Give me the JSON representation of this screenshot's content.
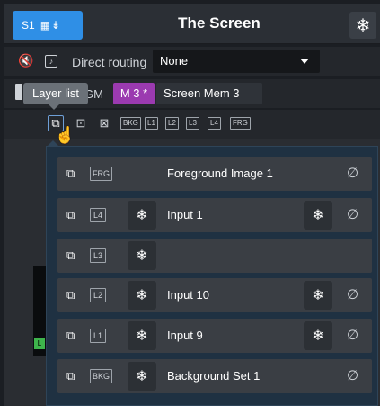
{
  "header": {
    "screen_badge": "S1",
    "screen_badge_icons": "▦⇟",
    "title": "The Screen",
    "freeze_icon": "❄"
  },
  "routing": {
    "mute_icon": "🔇",
    "checkbox_glyph": "♪",
    "label": "Direct routing",
    "selected": "None"
  },
  "memory": {
    "tooltip": "Layer list",
    "gm_label": "GM",
    "badge": "M 3 *",
    "name": "Screen Mem 3"
  },
  "toolbar": {
    "layer_list_icon": "⧉",
    "icon2": "⊡",
    "icon3": "⊠",
    "chips": [
      "BKG",
      "L1",
      "L2",
      "L3",
      "L4",
      "FRG"
    ],
    "cursor": "☝"
  },
  "side": {
    "green_label": "L"
  },
  "layers": [
    {
      "stack_icon": "⧉",
      "chip": "FRG",
      "freeze": "",
      "name": "Foreground Image 1",
      "freeze_right": "",
      "none": "∅"
    },
    {
      "stack_icon": "⧉",
      "chip": "L4",
      "freeze": "❄",
      "name": "Input 1",
      "freeze_right": "❄",
      "none": "∅"
    },
    {
      "stack_icon": "⧉",
      "chip": "L3",
      "freeze": "❄",
      "name": "",
      "freeze_right": "",
      "none": ""
    },
    {
      "stack_icon": "⧉",
      "chip": "L2",
      "freeze": "❄",
      "name": "Input 10",
      "freeze_right": "❄",
      "none": "∅"
    },
    {
      "stack_icon": "⧉",
      "chip": "L1",
      "freeze": "❄",
      "name": "Input 9",
      "freeze_right": "❄",
      "none": "∅"
    },
    {
      "stack_icon": "⧉",
      "chip": "BKG",
      "freeze": "❄",
      "name": "Background Set 1",
      "freeze_right": "",
      "none": "∅"
    }
  ]
}
